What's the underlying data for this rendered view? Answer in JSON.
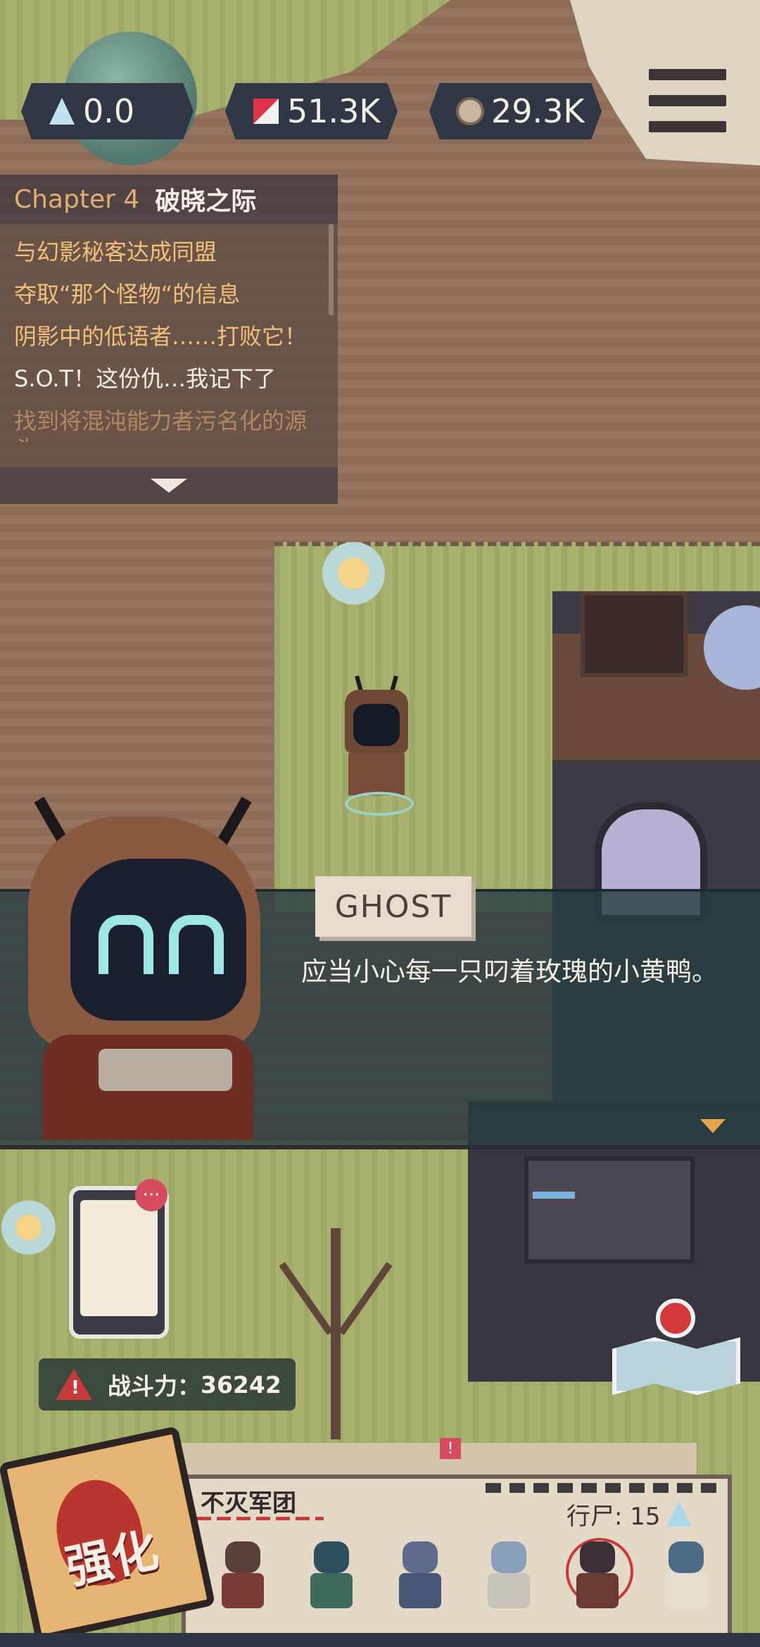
{
  "resources": {
    "crystal": {
      "value": "0.0",
      "icon": "crystal-icon"
    },
    "gear": {
      "value": "51.3K",
      "icon": "gear-parts-icon"
    },
    "coin": {
      "value": "29.3K",
      "icon": "coin-icon"
    }
  },
  "menu": {
    "icon": "hamburger-menu-icon"
  },
  "quest": {
    "chapter_number": "Chapter 4",
    "chapter_title": "破晓之际",
    "items": [
      {
        "text": "与幻影秘客达成同盟",
        "state": "done"
      },
      {
        "text": "夺取“那个怪物“的信息",
        "state": "done"
      },
      {
        "text": "阴影中的低语者……打败它！",
        "state": "done"
      },
      {
        "text": "S.O.T！这份仇…我记下了",
        "state": "active"
      },
      {
        "text": "找到将混沌能力者污名化的源头",
        "state": "next"
      }
    ]
  },
  "dialog": {
    "speaker": "GHOST",
    "text": "应当小心每一只叼着玫瑰的小黄鸭。"
  },
  "phone": {
    "badge": "···"
  },
  "power": {
    "label": "战斗力：",
    "value": "36242"
  },
  "squad": {
    "name": "不灭军团",
    "count": "行尸: 15",
    "alert": "!",
    "units": [
      {
        "name": "unit-1",
        "head": "#5a3f3c",
        "body": "#7b3b36"
      },
      {
        "name": "unit-2",
        "head": "#2f4f5f",
        "body": "#3f6b5a"
      },
      {
        "name": "unit-3",
        "head": "#5f6b8a",
        "body": "#4a5675"
      },
      {
        "name": "unit-4",
        "head": "#8a9fb8",
        "body": "#c9c4ba"
      },
      {
        "name": "unit-5",
        "head": "#3a2f36",
        "body": "#6b3a34"
      },
      {
        "name": "unit-6",
        "head": "#4d6b86",
        "body": "#e6ded0"
      }
    ]
  },
  "upgrade": {
    "label": "强化"
  },
  "colors": {
    "accent_gold": "#f0c07d",
    "alert_red": "#d64b5f",
    "panel_dark": "#2f3745"
  }
}
